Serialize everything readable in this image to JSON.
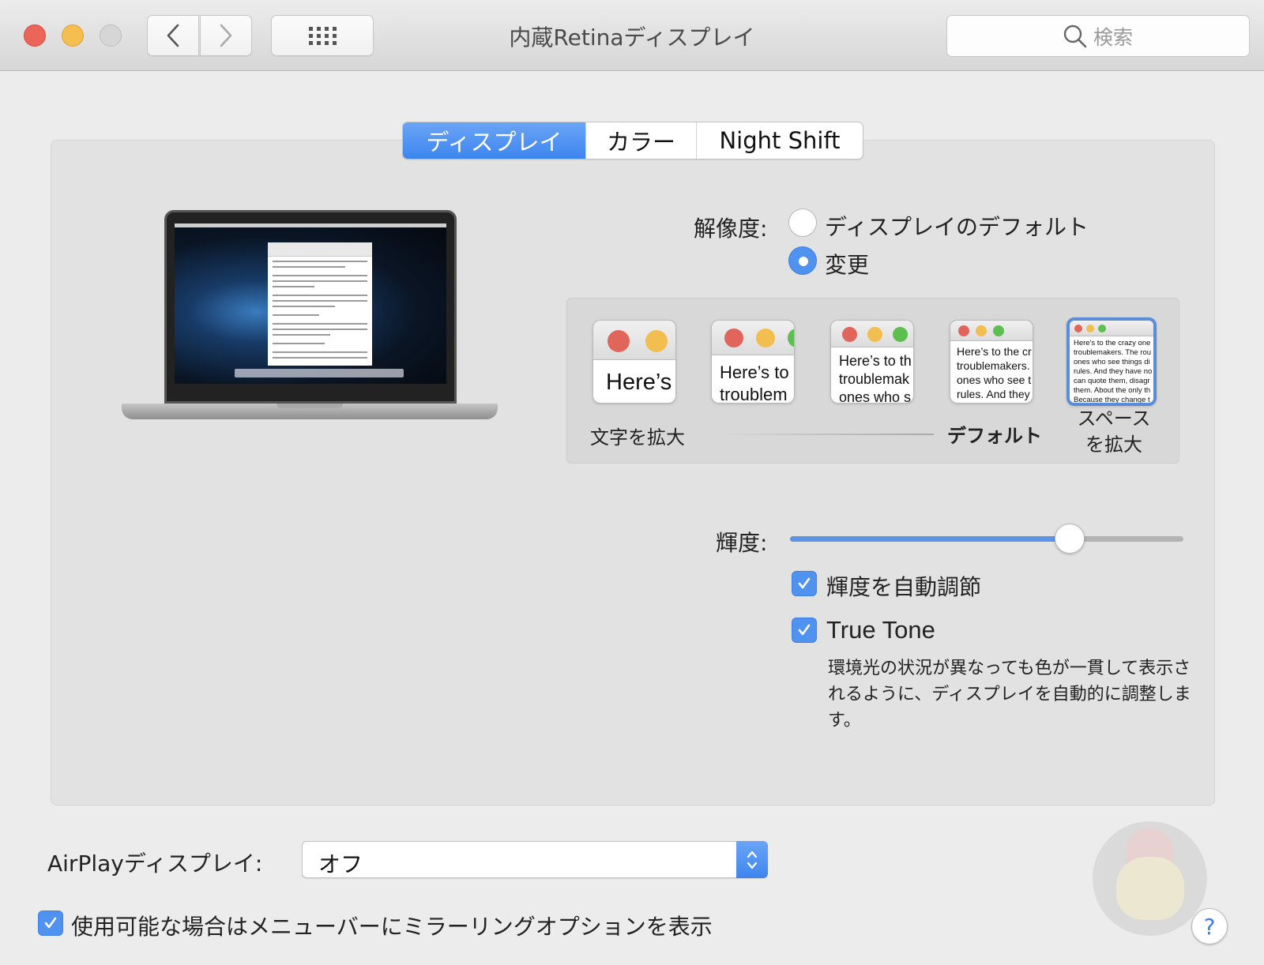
{
  "window": {
    "title": "内蔵Retinaディスプレイ",
    "search_placeholder": "検索",
    "icons": {
      "back": "chevron-left",
      "forward": "chevron-right",
      "grid": "show-all-grid",
      "search": "magnifier"
    }
  },
  "tabs": [
    {
      "label": "ディスプレイ",
      "active": true
    },
    {
      "label": "カラー",
      "active": false
    },
    {
      "label": "Night Shift",
      "active": false
    }
  ],
  "resolution": {
    "label": "解像度:",
    "options": [
      {
        "label": "ディスプレイのデフォルト",
        "selected": false
      },
      {
        "label": "変更",
        "selected": true
      }
    ],
    "scale_thumbnails": [
      {
        "text": "Here’s",
        "selected": false
      },
      {
        "text": "Here’s to\ntroublem",
        "selected": false
      },
      {
        "text": "Here’s to th\ntroublemak\nones who s",
        "selected": false
      },
      {
        "text": "Here’s to the cr\ntroublemakers.\nones who see t\nrules. And they",
        "selected": false
      },
      {
        "text": "Here's to the crazy one\ntroublemakers. The rou\nones who see things di\nrules. And they have no\ncan quote them, disagr\nthem. About the only th\nBecause they change t",
        "selected": true
      }
    ],
    "scale_labels": {
      "larger_text": "文字を拡大",
      "default": "デフォルト",
      "more_space": "スペース\nを拡大"
    }
  },
  "brightness": {
    "label": "輝度:",
    "value": 0.71,
    "auto_adjust": {
      "label": "輝度を自動調節",
      "checked": true
    },
    "true_tone": {
      "label": "True Tone",
      "checked": true,
      "description": "環境光の状況が異なっても色が一貫して表示されるように、ディスプレイを自動的に調整します。"
    }
  },
  "airplay": {
    "label": "AirPlayディスプレイ:",
    "selected": "オフ"
  },
  "mirroring": {
    "label": "使用可能な場合はメニューバーにミラーリングオプションを表示",
    "checked": true
  },
  "help_label": "?",
  "colors": {
    "accent": "#4f92ef",
    "close": "#ec6559",
    "minimize": "#f5bf4f",
    "zoom_disabled": "#d6d6d6",
    "panel_bg": "#e2e2e2",
    "window_bg": "#ececec"
  }
}
